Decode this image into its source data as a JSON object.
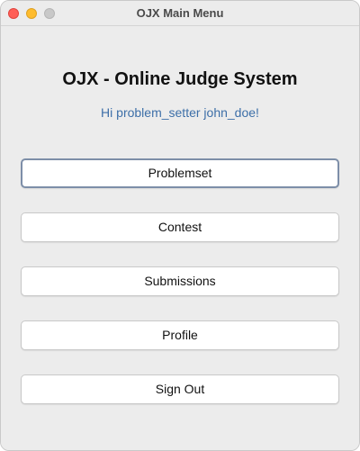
{
  "window": {
    "title": "OJX Main Menu"
  },
  "header": {
    "app_title": "OJX - Online Judge System",
    "greeting": "Hi problem_setter john_doe!"
  },
  "menu": {
    "buttons": [
      {
        "label": "Problemset",
        "focused": true
      },
      {
        "label": "Contest",
        "focused": false
      },
      {
        "label": "Submissions",
        "focused": false
      },
      {
        "label": "Profile",
        "focused": false
      },
      {
        "label": "Sign Out",
        "focused": false
      }
    ]
  },
  "colors": {
    "greeting": "#3d6fa8",
    "focus_ring": "#7d8ea8",
    "close": "#ff5f57",
    "minimize": "#febc2e",
    "zoom_disabled": "#c8c8c8"
  }
}
